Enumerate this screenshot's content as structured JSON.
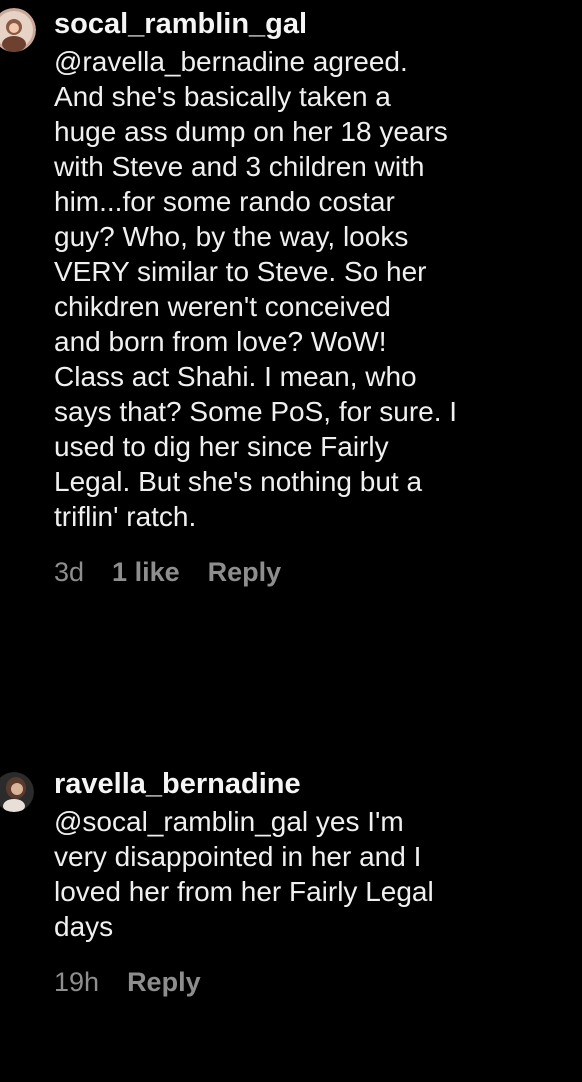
{
  "comments": [
    {
      "username": "socal_ramblin_gal",
      "lines": [
        "@ravella_bernadine agreed.",
        "And she's basically taken a",
        "huge ass dump on her 18 years",
        "with Steve and 3 children with",
        "him...for some rando costar",
        "guy? Who, by the way, looks",
        "VERY similar to Steve. So her",
        "chikdren weren't conceived",
        "and born from love? WoW!",
        "Class act Shahi. I mean, who",
        "says that? Some PoS, for sure. I",
        "used to dig her since Fairly",
        "Legal. But she's nothing but a",
        "triflin' ratch."
      ],
      "time": "3d",
      "likes": "1 like",
      "reply": "Reply"
    },
    {
      "username": "ravella_bernadine",
      "lines": [
        "@socal_ramblin_gal yes I'm",
        "very disappointed in her and I",
        "loved her from her Fairly Legal",
        "days"
      ],
      "time": "19h",
      "reply": "Reply"
    }
  ]
}
